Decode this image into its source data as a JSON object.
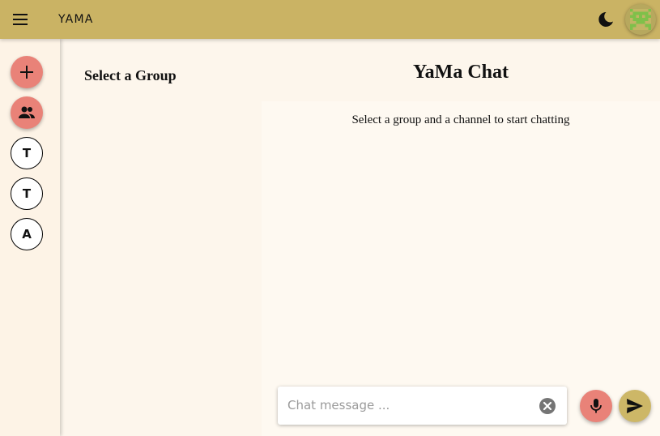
{
  "appbar": {
    "title": "YAMA",
    "background": "#cab364",
    "icons": {
      "menu": "menu-icon",
      "theme": "moon-icon",
      "avatar": "pixel-avatar-icon"
    }
  },
  "groups_rail": {
    "add_button_icon": "plus-icon",
    "people_button_icon": "people-icon",
    "groups": [
      {
        "initial": "T"
      },
      {
        "initial": "T"
      },
      {
        "initial": "A"
      }
    ],
    "accent": "#e98278"
  },
  "channel_panel": {
    "title": "Select a Group"
  },
  "chat": {
    "title": "YaMa Chat",
    "empty_message": "Select a group and a channel to start chatting"
  },
  "composer": {
    "placeholder": "Chat message ...",
    "value": "",
    "clear_icon": "clear-icon",
    "mic_icon": "mic-icon",
    "send_icon": "send-icon"
  }
}
